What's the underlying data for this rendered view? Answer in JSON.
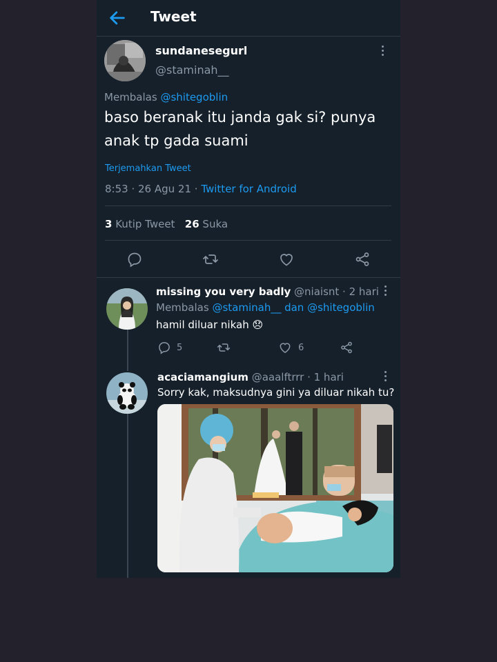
{
  "header": {
    "title": "Tweet",
    "back_icon": "arrow-left-icon"
  },
  "main_tweet": {
    "display_name": "sundanesegurl",
    "handle": "@staminah__",
    "reply_prefix": "Membalas",
    "reply_to": "@shitegoblin",
    "text_line1": "baso beranak itu janda gak si? punya",
    "text_line2": "anak tp gada suami",
    "translate": "Terjemahkan Tweet",
    "time_date": "8:53 · 26 Agu 21 ·",
    "client": "Twitter for Android",
    "quote_count": "3",
    "quote_label": "Kutip Tweet",
    "like_count": "26",
    "like_label": "Suka"
  },
  "reply1": {
    "display_name": "missing you very badly",
    "handle_time": "@niaisnt · 2 hari",
    "reply_prefix": "Membalas",
    "reply_to": "@staminah__ dan @shitegoblin",
    "text": "hamil diluar nikah 😞",
    "reply_count": "5",
    "like_count": "6"
  },
  "reply2": {
    "display_name": "acaciamangium",
    "handle_time": "@aaalftrrr · 1 hari",
    "text": "Sorry kak, maksudnya gini ya diluar nikah tu?"
  },
  "colors": {
    "background": "#15202b",
    "accent": "#1d9bf0",
    "page": "#23222c"
  }
}
